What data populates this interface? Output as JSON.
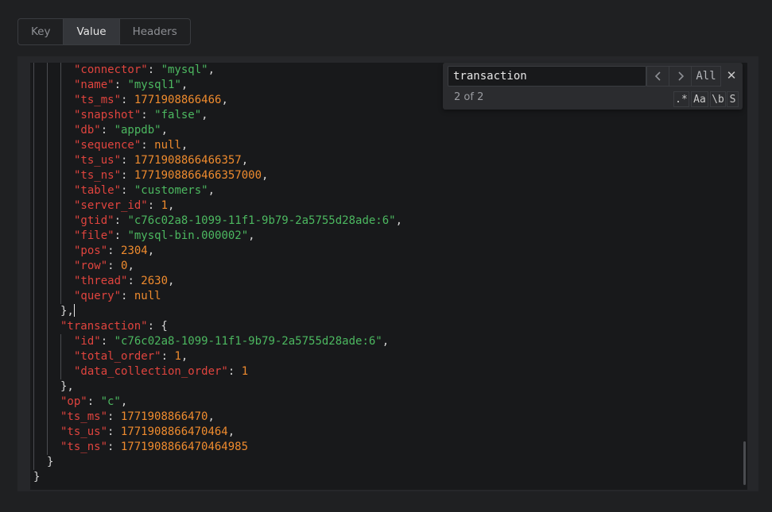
{
  "tabs": [
    {
      "label": "Key",
      "active": false
    },
    {
      "label": "Value",
      "active": true
    },
    {
      "label": "Headers",
      "active": false
    }
  ],
  "search": {
    "query": "transaction",
    "count": "2 of 2",
    "prev_icon": "chevron-left-icon",
    "next_icon": "chevron-right-icon",
    "all_label": "All",
    "close_icon": "close-icon",
    "regex_label": ".*",
    "case_label": "Aa",
    "word_label": "\\b",
    "selection_label": "S"
  },
  "colors": {
    "key": "#e0443e",
    "string": "#4cb860",
    "number": "#ef8b2e"
  },
  "code_lines": [
    {
      "guides": 3,
      "parts": [
        [
          "k",
          "\"connector\""
        ],
        [
          "p",
          ": "
        ],
        [
          "s",
          "\"mysql\""
        ],
        [
          "p",
          ","
        ]
      ]
    },
    {
      "guides": 3,
      "parts": [
        [
          "k",
          "\"name\""
        ],
        [
          "p",
          ": "
        ],
        [
          "s",
          "\"mysql1\""
        ],
        [
          "p",
          ","
        ]
      ]
    },
    {
      "guides": 3,
      "parts": [
        [
          "k",
          "\"ts_ms\""
        ],
        [
          "p",
          ": "
        ],
        [
          "n",
          "1771908866466"
        ],
        [
          "p",
          ","
        ]
      ]
    },
    {
      "guides": 3,
      "parts": [
        [
          "k",
          "\"snapshot\""
        ],
        [
          "p",
          ": "
        ],
        [
          "s",
          "\"false\""
        ],
        [
          "p",
          ","
        ]
      ]
    },
    {
      "guides": 3,
      "parts": [
        [
          "k",
          "\"db\""
        ],
        [
          "p",
          ": "
        ],
        [
          "s",
          "\"appdb\""
        ],
        [
          "p",
          ","
        ]
      ]
    },
    {
      "guides": 3,
      "parts": [
        [
          "k",
          "\"sequence\""
        ],
        [
          "p",
          ": "
        ],
        [
          "l",
          "null"
        ],
        [
          "p",
          ","
        ]
      ]
    },
    {
      "guides": 3,
      "parts": [
        [
          "k",
          "\"ts_us\""
        ],
        [
          "p",
          ": "
        ],
        [
          "n",
          "1771908866466357"
        ],
        [
          "p",
          ","
        ]
      ]
    },
    {
      "guides": 3,
      "parts": [
        [
          "k",
          "\"ts_ns\""
        ],
        [
          "p",
          ": "
        ],
        [
          "n",
          "1771908866466357000"
        ],
        [
          "p",
          ","
        ]
      ]
    },
    {
      "guides": 3,
      "parts": [
        [
          "k",
          "\"table\""
        ],
        [
          "p",
          ": "
        ],
        [
          "s",
          "\"customers\""
        ],
        [
          "p",
          ","
        ]
      ]
    },
    {
      "guides": 3,
      "parts": [
        [
          "k",
          "\"server_id\""
        ],
        [
          "p",
          ": "
        ],
        [
          "n",
          "1"
        ],
        [
          "p",
          ","
        ]
      ]
    },
    {
      "guides": 3,
      "parts": [
        [
          "k",
          "\"gtid\""
        ],
        [
          "p",
          ": "
        ],
        [
          "s",
          "\"c76c02a8-1099-11f1-9b79-2a5755d28ade:6\""
        ],
        [
          "p",
          ","
        ]
      ]
    },
    {
      "guides": 3,
      "parts": [
        [
          "k",
          "\"file\""
        ],
        [
          "p",
          ": "
        ],
        [
          "s",
          "\"mysql-bin.000002\""
        ],
        [
          "p",
          ","
        ]
      ]
    },
    {
      "guides": 3,
      "parts": [
        [
          "k",
          "\"pos\""
        ],
        [
          "p",
          ": "
        ],
        [
          "n",
          "2304"
        ],
        [
          "p",
          ","
        ]
      ]
    },
    {
      "guides": 3,
      "parts": [
        [
          "k",
          "\"row\""
        ],
        [
          "p",
          ": "
        ],
        [
          "n",
          "0"
        ],
        [
          "p",
          ","
        ]
      ]
    },
    {
      "guides": 3,
      "parts": [
        [
          "k",
          "\"thread\""
        ],
        [
          "p",
          ": "
        ],
        [
          "n",
          "2630"
        ],
        [
          "p",
          ","
        ]
      ]
    },
    {
      "guides": 3,
      "parts": [
        [
          "k",
          "\"query\""
        ],
        [
          "p",
          ": "
        ],
        [
          "l",
          "null"
        ]
      ]
    },
    {
      "guides": 2,
      "parts": [
        [
          "p",
          "},"
        ]
      ],
      "caret": true
    },
    {
      "guides": 2,
      "parts": [
        [
          "k",
          "\"transaction\""
        ],
        [
          "p",
          ": {"
        ]
      ]
    },
    {
      "guides": 3,
      "parts": [
        [
          "k",
          "\"id\""
        ],
        [
          "p",
          ": "
        ],
        [
          "s",
          "\"c76c02a8-1099-11f1-9b79-2a5755d28ade:6\""
        ],
        [
          "p",
          ","
        ]
      ]
    },
    {
      "guides": 3,
      "parts": [
        [
          "k",
          "\"total_order\""
        ],
        [
          "p",
          ": "
        ],
        [
          "n",
          "1"
        ],
        [
          "p",
          ","
        ]
      ]
    },
    {
      "guides": 3,
      "parts": [
        [
          "k",
          "\"data_collection_order\""
        ],
        [
          "p",
          ": "
        ],
        [
          "n",
          "1"
        ]
      ]
    },
    {
      "guides": 2,
      "parts": [
        [
          "p",
          "},"
        ]
      ]
    },
    {
      "guides": 2,
      "parts": [
        [
          "k",
          "\"op\""
        ],
        [
          "p",
          ": "
        ],
        [
          "s",
          "\"c\""
        ],
        [
          "p",
          ","
        ]
      ]
    },
    {
      "guides": 2,
      "parts": [
        [
          "k",
          "\"ts_ms\""
        ],
        [
          "p",
          ": "
        ],
        [
          "n",
          "1771908866470"
        ],
        [
          "p",
          ","
        ]
      ]
    },
    {
      "guides": 2,
      "parts": [
        [
          "k",
          "\"ts_us\""
        ],
        [
          "p",
          ": "
        ],
        [
          "n",
          "1771908866470464"
        ],
        [
          "p",
          ","
        ]
      ]
    },
    {
      "guides": 2,
      "parts": [
        [
          "k",
          "\"ts_ns\""
        ],
        [
          "p",
          ": "
        ],
        [
          "n",
          "1771908866470464985"
        ]
      ]
    },
    {
      "guides": 1,
      "parts": [
        [
          "p",
          "}"
        ]
      ]
    },
    {
      "guides": 0,
      "parts": [
        [
          "p",
          "}"
        ]
      ]
    }
  ]
}
